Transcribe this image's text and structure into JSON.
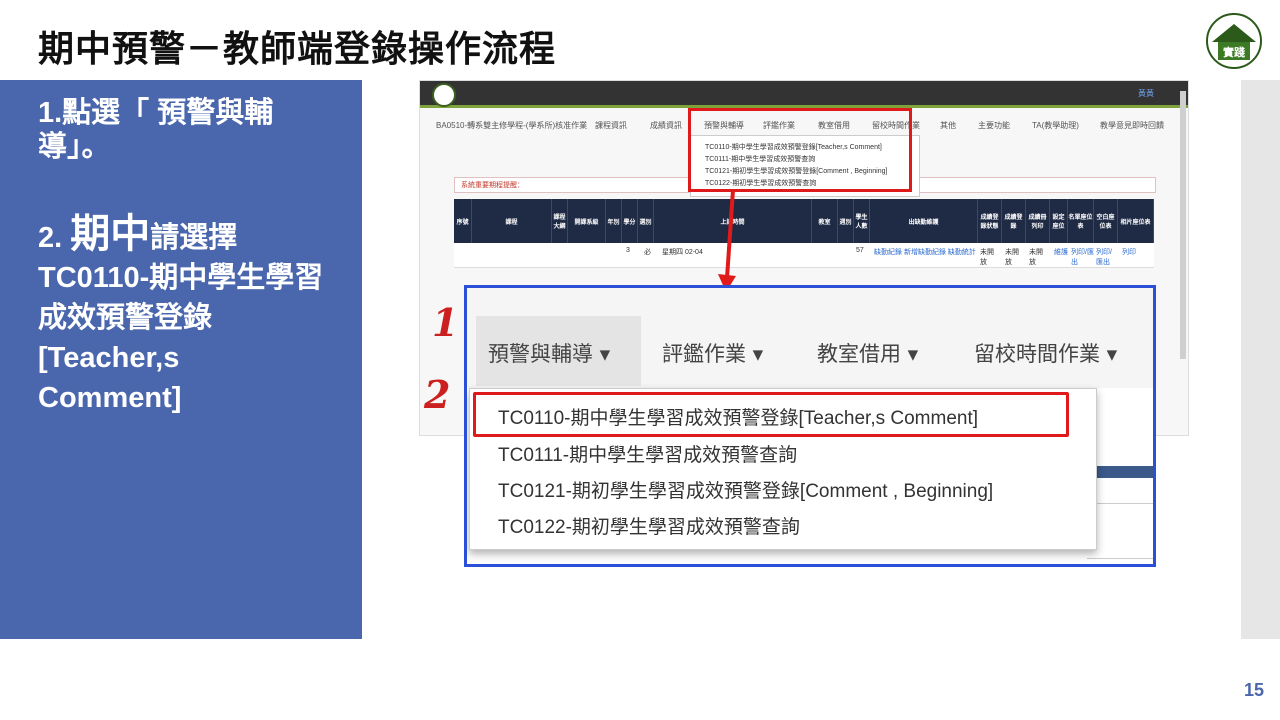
{
  "slide": {
    "title": "期中預警－教師端登錄操作流程",
    "page_number": "15",
    "logo_text": "實踐"
  },
  "instructions": {
    "step1": "1.點選「 預警與輔導」。",
    "step2_prefix": "2. ",
    "step2_big": "期中",
    "step2_rest": "請選擇TC0110-期中學生學習成效預警登錄 [Teacher,s Comment]"
  },
  "screenshot": {
    "user": "黃黃",
    "nav": [
      "BA0510-轉系雙主修學程-(學系所)核准作業",
      "課程資訊",
      "成績資訊",
      "預警與輔導",
      "評鑑作業",
      "教室借用",
      "留校時間作業",
      "其他",
      "主要功能",
      "TA(教學助理)",
      "教學意見即時回饋"
    ],
    "menu": [
      "TC0110-期中學生學習成效預警登錄[Teacher,s Comment]",
      "TC0111-期中學生學習成效預警查詢",
      "TC0121-期初學生學習成效預警登錄[Comment , Beginning]",
      "TC0122-期初學生學習成效預警查詢"
    ],
    "alert": "系統重要期程提醒：",
    "table_headers": [
      "序號",
      "課程",
      "課程大綱",
      "開課系級",
      "年別",
      "學分",
      "選別",
      "上課時間",
      "教室",
      "週別",
      "學生人數",
      "出缺勤維護",
      "成績登錄狀態",
      "成績登錄",
      "成績冊列印",
      "設定座位",
      "名單座位表",
      "空白座位表",
      "相片座位表"
    ],
    "row": {
      "year": "3",
      "credit": "必",
      "time": "星期四 02-04",
      "students": "57",
      "attendance": "缺勤紀錄 新增缺勤紀錄 缺勤統計",
      "status": "未開放",
      "login": "未開放",
      "print": "未開放",
      "seat": "維護",
      "list": "列印/匯出",
      "blank": "列印/匯出",
      "photo": "列印"
    }
  },
  "zoom": {
    "nav": [
      "預警與輔導 ▾",
      "評鑑作業 ▾",
      "教室借用 ▾",
      "留校時間作業 ▾"
    ],
    "items": [
      "TC0110-期中學生學習成效預警登錄[Teacher,s Comment]",
      "TC0111-期中學生學習成效預警查詢",
      "TC0121-期初學生學習成效預警登錄[Comment , Beginning]",
      "TC0122-期初學生學習成效預警查詢"
    ]
  },
  "labels": {
    "one": "1",
    "two": "2"
  },
  "colors": {
    "panel": "#4a66ad",
    "highlight": "#e01a1a",
    "zoom_border": "#2b4fd6"
  }
}
